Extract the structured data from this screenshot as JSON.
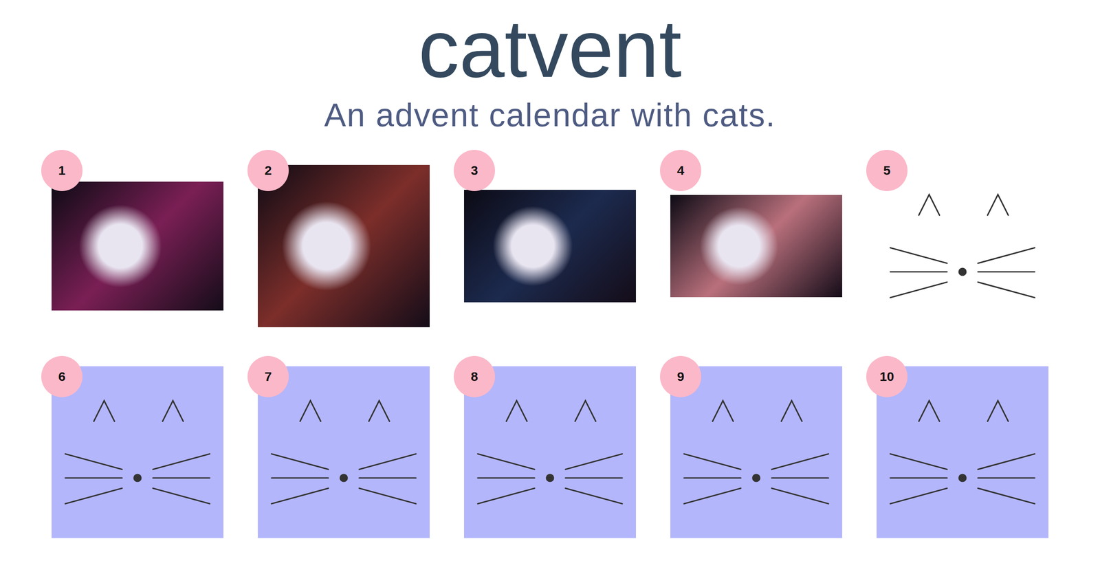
{
  "header": {
    "title": "catvent",
    "subtitle": "An advent calendar with cats."
  },
  "days": [
    {
      "number": "1",
      "opened": true,
      "kind": "photo",
      "color": "#7a1f55"
    },
    {
      "number": "2",
      "opened": true,
      "kind": "photo",
      "color": "#7c2e2a"
    },
    {
      "number": "3",
      "opened": true,
      "kind": "photo",
      "color": "#1c2a4e"
    },
    {
      "number": "4",
      "opened": true,
      "kind": "photo",
      "color": "#b9707c"
    },
    {
      "number": "5",
      "opened": true,
      "kind": "face"
    },
    {
      "number": "6",
      "opened": false,
      "kind": "face"
    },
    {
      "number": "7",
      "opened": false,
      "kind": "face"
    },
    {
      "number": "8",
      "opened": false,
      "kind": "face"
    },
    {
      "number": "9",
      "opened": false,
      "kind": "face"
    },
    {
      "number": "10",
      "opened": false,
      "kind": "face"
    }
  ]
}
